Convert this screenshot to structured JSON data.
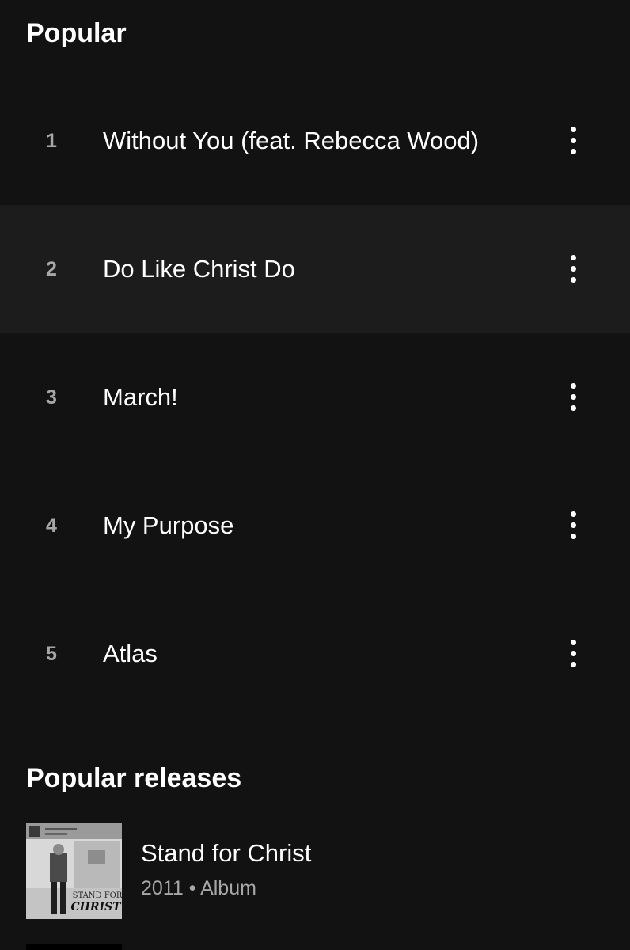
{
  "popular": {
    "title": "Popular",
    "tracks": [
      {
        "number": "1",
        "title": "Without You (feat. Rebecca Wood)"
      },
      {
        "number": "2",
        "title": "Do Like Christ Do"
      },
      {
        "number": "3",
        "title": "March!"
      },
      {
        "number": "4",
        "title": "My Purpose"
      },
      {
        "number": "5",
        "title": "Atlas"
      }
    ],
    "highlighted_track_index": 1
  },
  "releases": {
    "title": "Popular releases",
    "items": [
      {
        "title": "Stand for Christ",
        "year": "2011",
        "separator": "•",
        "type": "Album",
        "cover_text": [
          "STAND FOR",
          "CHRIST"
        ]
      }
    ]
  },
  "colors": {
    "background": "#121212",
    "highlight_row": "#1c1c1c",
    "primary_text": "#ffffff",
    "secondary_text": "#a7a7a7"
  }
}
